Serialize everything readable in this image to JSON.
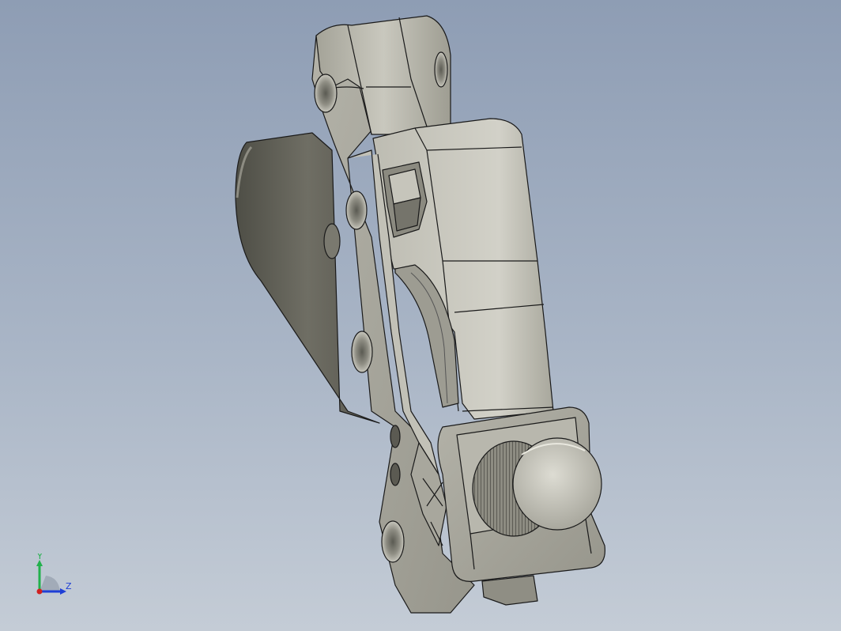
{
  "viewport": {
    "background_top": "#8e9db4",
    "background_bottom": "#c4ccd6",
    "part_color": "#b9b8ad",
    "edge_color": "#1a1a1a"
  },
  "triad": {
    "y_label": "Y",
    "z_label": "Z",
    "y_color": "#22b14c",
    "z_color": "#1f3fd6",
    "x_color": "#d02020"
  }
}
